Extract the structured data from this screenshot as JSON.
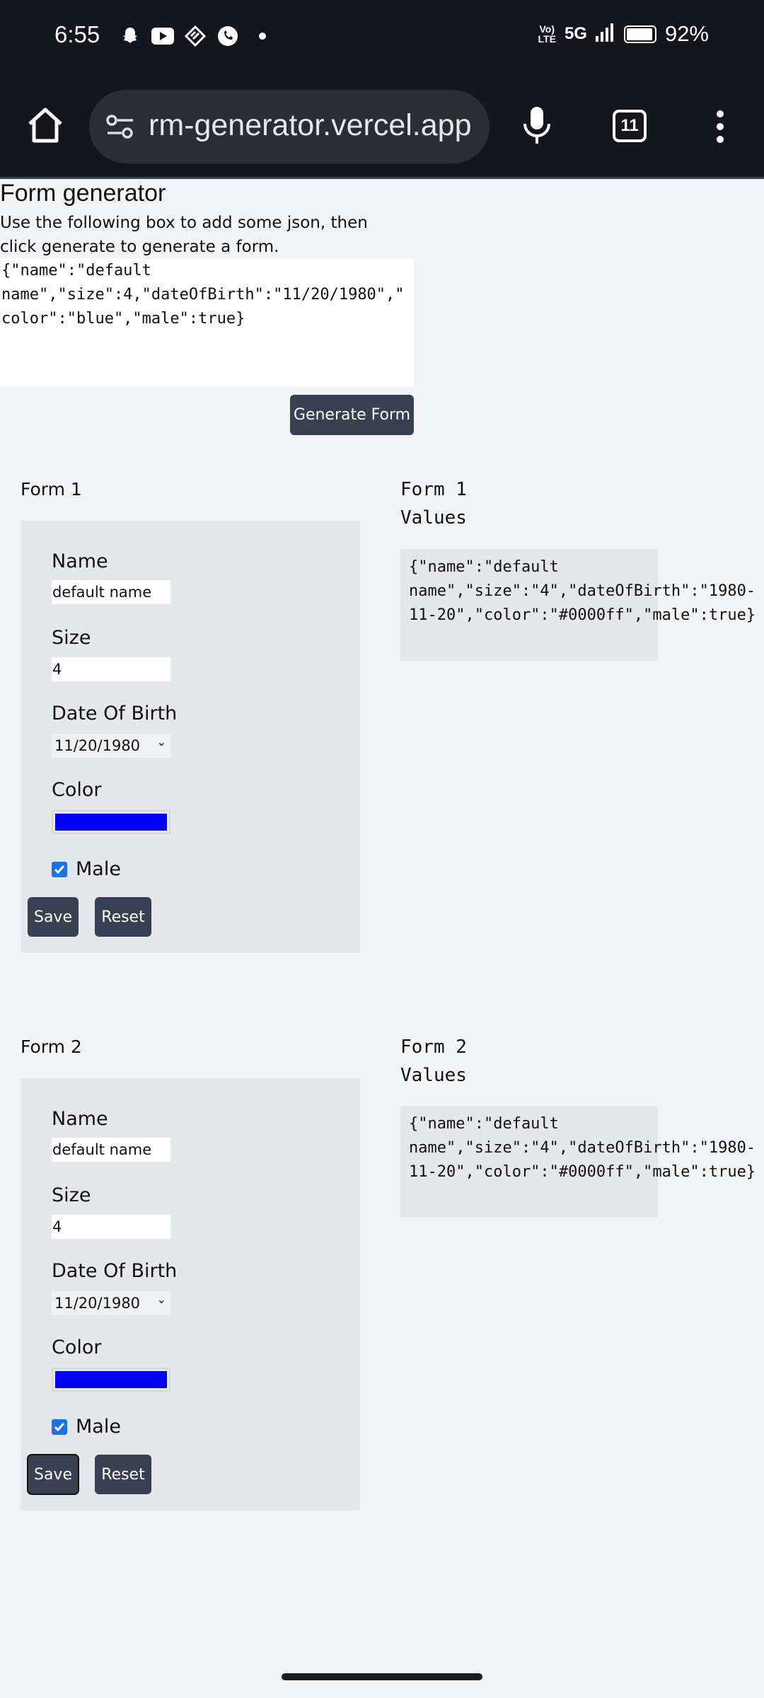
{
  "status_bar": {
    "time": "6:55",
    "network_volte": "VoLTE",
    "network": "5G",
    "battery": "92%",
    "battery_level": 0.92
  },
  "browser": {
    "url": "rm-generator.vercel.app",
    "tab_count": "11"
  },
  "page": {
    "title": "Form generator",
    "description": "Use the following box to add some json, then click generate to generate a form.",
    "json_input": "{\"name\":\"default name\",\"size\":4,\"dateOfBirth\":\"11/20/1980\",\"color\":\"blue\",\"male\":true}",
    "generate_label": "Generate Form"
  },
  "forms": [
    {
      "heading": "Form 1",
      "values_heading": "Form 1 Values",
      "name_label": "Name",
      "name_value": "default name",
      "size_label": "Size",
      "size_value": "4",
      "dob_label": "Date Of Birth",
      "dob_value": "11/20/1980",
      "color_label": "Color",
      "color_value": "#0000ff",
      "male_label": "Male",
      "male_checked": true,
      "save_label": "Save",
      "reset_label": "Reset",
      "values_json": "{\"name\":\"default name\",\"size\":\"4\",\"dateOfBirth\":\"1980-11-20\",\"color\":\"#0000ff\",\"male\":true}"
    },
    {
      "heading": "Form 2",
      "values_heading": "Form 2 Values",
      "name_label": "Name",
      "name_value": "default name",
      "size_label": "Size",
      "size_value": "4",
      "dob_label": "Date Of Birth",
      "dob_value": "11/20/1980",
      "color_label": "Color",
      "color_value": "#0000ff",
      "male_label": "Male",
      "male_checked": true,
      "save_label": "Save",
      "reset_label": "Reset",
      "values_json": "{\"name\":\"default name\",\"size\":\"4\",\"dateOfBirth\":\"1980-11-20\",\"color\":\"#0000ff\",\"male\":true}"
    }
  ]
}
